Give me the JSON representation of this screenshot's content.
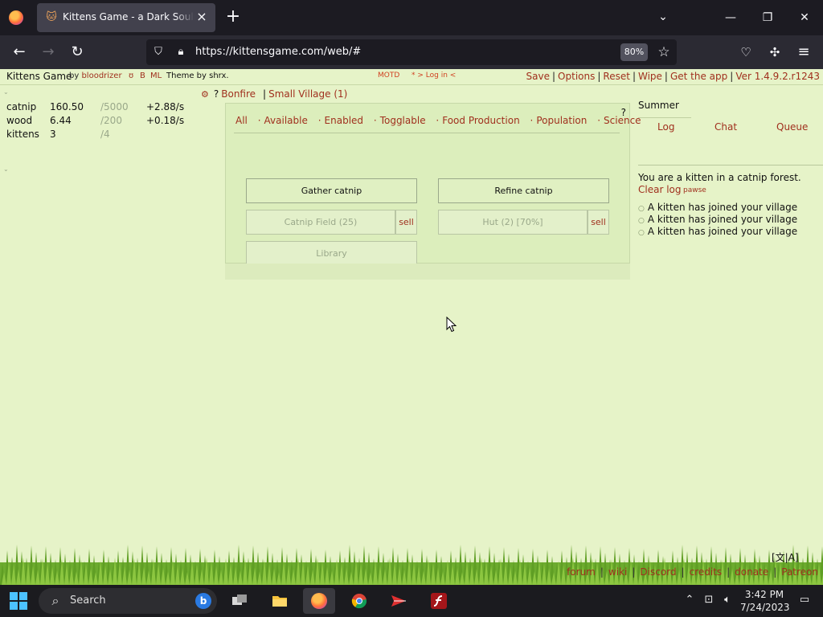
{
  "browser": {
    "tab_title": "Kittens Game - a Dark Souls of incremental games",
    "url": "https://kittensgame.com/web/#",
    "zoom": "80%"
  },
  "game": {
    "title": "Kittens Game",
    "by": "by",
    "author": "bloodrizer",
    "mini_links": [
      "ʊ",
      "B",
      "ML"
    ],
    "theme_by": "Theme by shrx.",
    "motd": "MOTD",
    "login": "* > Log in <",
    "menu": [
      "Save",
      "Options",
      "Reset",
      "Wipe",
      "Get the app",
      "Ver 1.4.9.2.r1243"
    ]
  },
  "resources": [
    {
      "name": "catnip",
      "amount": "160.50",
      "max": "/5000",
      "rate": "+2.88/s"
    },
    {
      "name": "wood",
      "amount": "6.44",
      "max": "/200",
      "rate": "+0.18/s"
    },
    {
      "name": "kittens",
      "amount": "3",
      "max": "/4",
      "rate": ""
    }
  ],
  "location": {
    "gear": "⚙",
    "help": "?",
    "bonfire": "Bonfire",
    "separator": "|",
    "village": "Small Village (1)"
  },
  "center": {
    "help": "?",
    "filters": [
      "All",
      "Available",
      "Enabled",
      "Togglable",
      "Food Production",
      "Population",
      "Science"
    ],
    "buttons": {
      "gather": "Gather catnip",
      "refine": "Refine catnip",
      "catnip_field": "Catnip Field (25)",
      "hut": "Hut (2) [70%]",
      "library": "Library",
      "sell": "sell"
    }
  },
  "right": {
    "season": "Summer",
    "tabs": [
      "Log",
      "Chat",
      "Queue"
    ],
    "log_message": "You are a kitten in a catnip forest.",
    "clear_log": "Clear log",
    "pawse": "pawse",
    "log_items": [
      "A kitten has joined your village",
      "A kitten has joined your village",
      "A kitten has joined your village"
    ]
  },
  "footer": {
    "lang": "[文|A]",
    "links": [
      "forum",
      "wiki",
      "Discord",
      "credits",
      "donate",
      "Patreon"
    ]
  },
  "taskbar": {
    "search_label": "Search",
    "time": "3:42 PM",
    "date": "7/24/2023"
  },
  "colors": {
    "page_bg": "#e6f3c8",
    "link": "#a0301e",
    "panel": "#dceebc"
  }
}
